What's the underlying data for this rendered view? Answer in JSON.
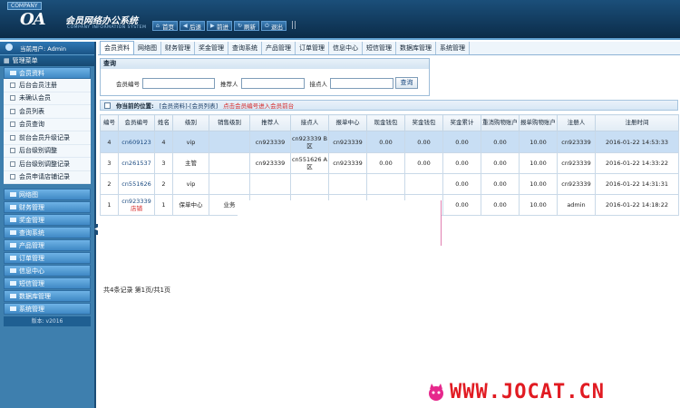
{
  "header": {
    "company": "COMPANY",
    "logo": "OA",
    "title": "会员网络办公系统",
    "subtitle": "COMPANY INFORMATION SYSTEM",
    "nav": [
      {
        "label": "首页",
        "icon": "home-icon"
      },
      {
        "label": "后退",
        "icon": "back-icon"
      },
      {
        "label": "前进",
        "icon": "forward-icon"
      },
      {
        "label": "刷新",
        "icon": "refresh-icon"
      },
      {
        "label": "退出",
        "icon": "exit-icon"
      }
    ]
  },
  "sidebar": {
    "current_user": "当前用户: Admin",
    "menu_title": "管理菜单",
    "open_category": "会员资料",
    "sub_items": [
      "后台会员注册",
      "未确认会员",
      "会员列表",
      "会员查询",
      "前台会员升级记录",
      "后台级别调整",
      "后台级别调整记录",
      "会员申请店铺记录"
    ],
    "categories": [
      "网络图",
      "财务管理",
      "奖金管理",
      "查询系统",
      "产品管理",
      "订单管理",
      "信息中心",
      "短信管理",
      "数据库管理",
      "系统管理"
    ],
    "version": "版本: v2016"
  },
  "tabs": [
    "会员资料",
    "网络图",
    "财务管理",
    "奖金管理",
    "查询系统",
    "产品管理",
    "订单管理",
    "信息中心",
    "短信管理",
    "数据库管理",
    "系统管理"
  ],
  "query": {
    "title": "查询",
    "member_label": "会员编号",
    "referrer_label": "推荐人",
    "node_label": "接点人",
    "member_value": "",
    "referrer_value": "",
    "node_value": "",
    "button": "查询"
  },
  "location": {
    "label": "你当前的位置:",
    "path": "[会员资料]-[会员列表]",
    "hint": "点击会员编号进入会员前台"
  },
  "table": {
    "headers": [
      "编号",
      "会员编号",
      "姓名",
      "级别",
      "销售级别",
      "推荐人",
      "接点人",
      "报单中心",
      "现金钱包",
      "奖金钱包",
      "奖金累计",
      "重消购物账户",
      "报单购物账户",
      "注册人",
      "注册时间"
    ],
    "rows": [
      {
        "no": "4",
        "code": "cn609123",
        "code_note": "",
        "name": "4",
        "level": "vip",
        "sales_level": "",
        "referrer": "cn923339",
        "node": "cn923339 B区",
        "center": "cn923339",
        "cash": "0.00",
        "bonus": "0.00",
        "bonus_total": "0.00",
        "consume": "0.00",
        "order_acc": "10.00",
        "registrar": "cn923339",
        "time": "2016-01-22 14:53:33"
      },
      {
        "no": "3",
        "code": "cn261537",
        "code_note": "",
        "name": "3",
        "level": "主管",
        "sales_level": "",
        "referrer": "cn923339",
        "node": "cn551626 A区",
        "center": "cn923339",
        "cash": "0.00",
        "bonus": "0.00",
        "bonus_total": "0.00",
        "consume": "0.00",
        "order_acc": "10.00",
        "registrar": "cn923339",
        "time": "2016-01-22 14:33:22"
      },
      {
        "no": "2",
        "code": "cn551626",
        "code_note": "",
        "name": "2",
        "level": "vip",
        "sales_level": "",
        "referrer": "",
        "node": "",
        "center": "",
        "cash": "",
        "bonus": "",
        "bonus_total": "0.00",
        "consume": "0.00",
        "order_acc": "10.00",
        "registrar": "cn923339",
        "time": "2016-01-22 14:31:31"
      },
      {
        "no": "1",
        "code": "cn923339",
        "code_note": "店铺",
        "name": "1",
        "level": "保单中心",
        "sales_level": "业务",
        "referrer": "",
        "node": "",
        "center": "",
        "cash": "",
        "bonus": "",
        "bonus_total": "0.00",
        "consume": "0.00",
        "order_acc": "10.00",
        "registrar": "admin",
        "time": "2016-01-22 14:18:22"
      }
    ]
  },
  "footer": "共4条记录   第1页/共1页",
  "watermark": "WWW.JOCAT.CN",
  "colors": {
    "accent": "#1b4f7a",
    "sidebar": "#3e7fae",
    "selected_row": "#c8def4",
    "hint_red": "#d62828"
  }
}
